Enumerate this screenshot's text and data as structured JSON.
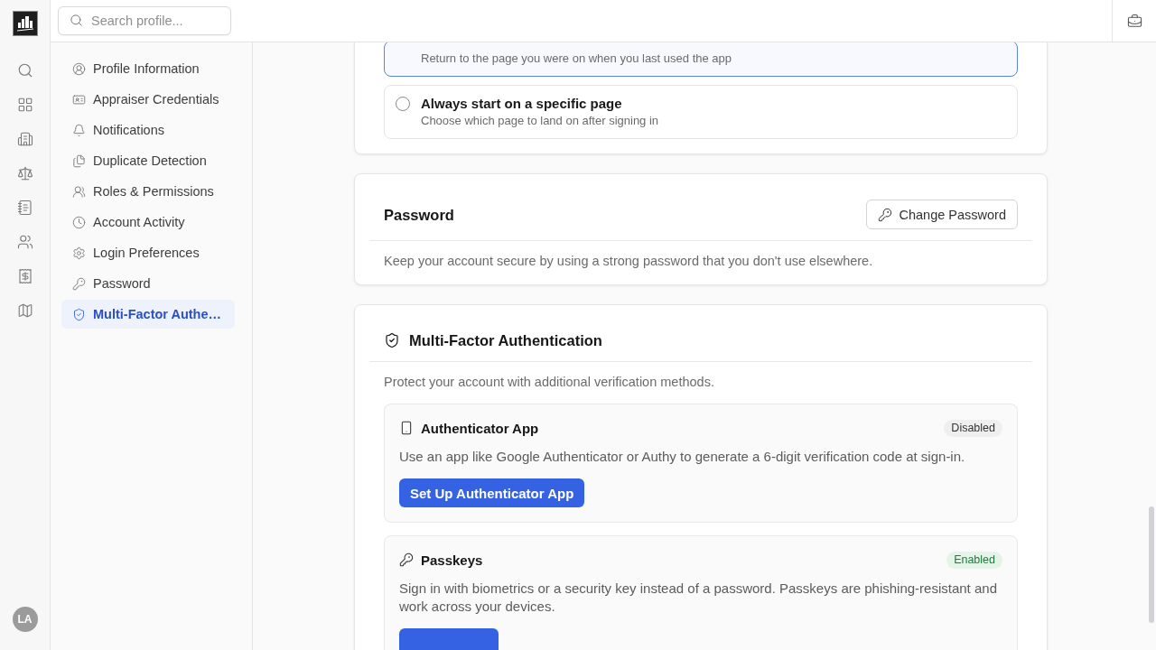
{
  "rail": {
    "avatar": "LA"
  },
  "search": {
    "placeholder": "Search profile..."
  },
  "sidebar": {
    "items": [
      {
        "label": "Profile Information",
        "selected": false
      },
      {
        "label": "Appraiser Credentials",
        "selected": false
      },
      {
        "label": "Notifications",
        "selected": false
      },
      {
        "label": "Duplicate Detection",
        "selected": false
      },
      {
        "label": "Roles & Permissions",
        "selected": false
      },
      {
        "label": "Account Activity",
        "selected": false
      },
      {
        "label": "Login Preferences",
        "selected": false
      },
      {
        "label": "Password",
        "selected": false
      },
      {
        "label": "Multi-Factor Authe…",
        "selected": true
      }
    ]
  },
  "login_preferences": {
    "options": [
      {
        "description": "Return to the page you were on when you last used the app",
        "selected": true
      },
      {
        "title": "Always start on a specific page",
        "description": "Choose which page to land on after signing in",
        "selected": false
      }
    ]
  },
  "password": {
    "title": "Password",
    "button": "Change Password",
    "description": "Keep your account secure by using a strong password that you don't use elsewhere."
  },
  "mfa": {
    "title": "Multi-Factor Authentication",
    "description": "Protect your account with additional verification methods.",
    "methods": [
      {
        "kind": "app",
        "title": "Authenticator App",
        "status": "Disabled",
        "enabled": false,
        "description": "Use an app like Google Authenticator or Authy to generate a 6-digit verification code at sign-in.",
        "button": "Set Up Authenticator App"
      },
      {
        "kind": "passkey",
        "title": "Passkeys",
        "status": "Enabled",
        "enabled": true,
        "description": "Sign in with biometrics or a security key instead of a password. Passkeys are phishing-resistant and work across your devices."
      }
    ]
  }
}
